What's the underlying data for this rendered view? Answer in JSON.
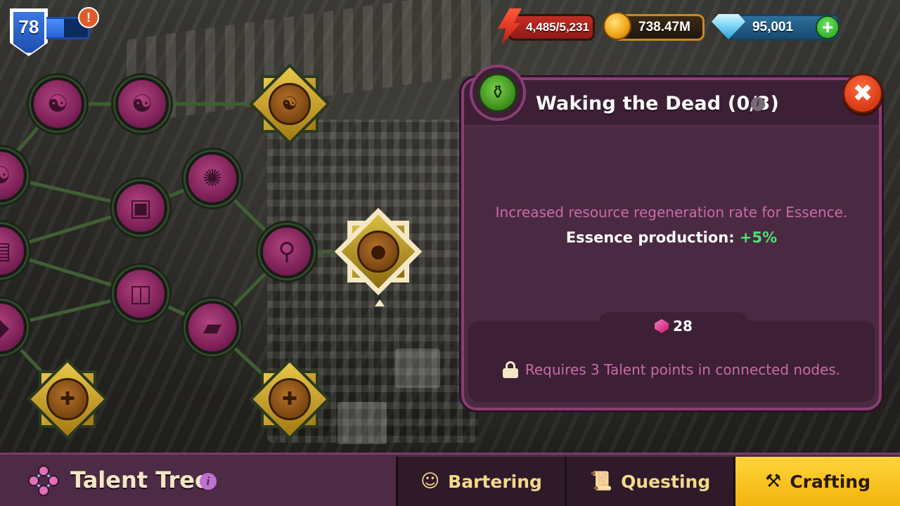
{
  "hud": {
    "level": "78",
    "xp_progress": 0.45,
    "alert_badge": "!",
    "energy": "4,485/5,231",
    "gold": "738.47M",
    "gems": "95,001",
    "plus_label": "+"
  },
  "tree": {
    "nodes": [
      {
        "id": "yin-yang-1",
        "type": "small",
        "glyph": "☯"
      },
      {
        "id": "yin-yang-2",
        "type": "small",
        "glyph": "☯"
      },
      {
        "id": "yin-yang-star",
        "type": "star",
        "glyph": "☯"
      },
      {
        "id": "spider",
        "type": "small",
        "glyph": "✺"
      },
      {
        "id": "crate",
        "type": "small",
        "glyph": "▣"
      },
      {
        "id": "totem",
        "type": "small",
        "glyph": "⚲"
      },
      {
        "id": "cube",
        "type": "small",
        "glyph": "◫"
      },
      {
        "id": "ingot",
        "type": "small",
        "glyph": "▰"
      },
      {
        "id": "book-star",
        "type": "star",
        "glyph": "✚"
      },
      {
        "id": "scroll-star",
        "type": "star",
        "glyph": "✚"
      },
      {
        "id": "selected-star",
        "type": "star",
        "glyph": "●"
      }
    ]
  },
  "panel": {
    "title": "Waking the Dead (0/3)",
    "info_label": "i",
    "close_label": "✖",
    "description": "Increased resource regeneration rate for Essence.",
    "stat_label": "Essence production: ",
    "stat_value": "+5%",
    "cost": "28",
    "requirement": "Requires 3 Talent points in connected nodes."
  },
  "bottom": {
    "title": "Talent Tree",
    "info_label": "i",
    "tabs": [
      {
        "label": "Bartering",
        "icon": "smiley-icon",
        "active": false
      },
      {
        "label": "Questing",
        "icon": "scroll-icon",
        "active": false
      },
      {
        "label": "Crafting",
        "icon": "anvil-icon",
        "active": true
      }
    ]
  },
  "colors": {
    "panel_bg": "#4a2a42",
    "panel_border": "#8c3d74",
    "desc_text": "#c96aa8",
    "stat_value": "#4fe07a",
    "active_tab": "#f2b40e"
  }
}
